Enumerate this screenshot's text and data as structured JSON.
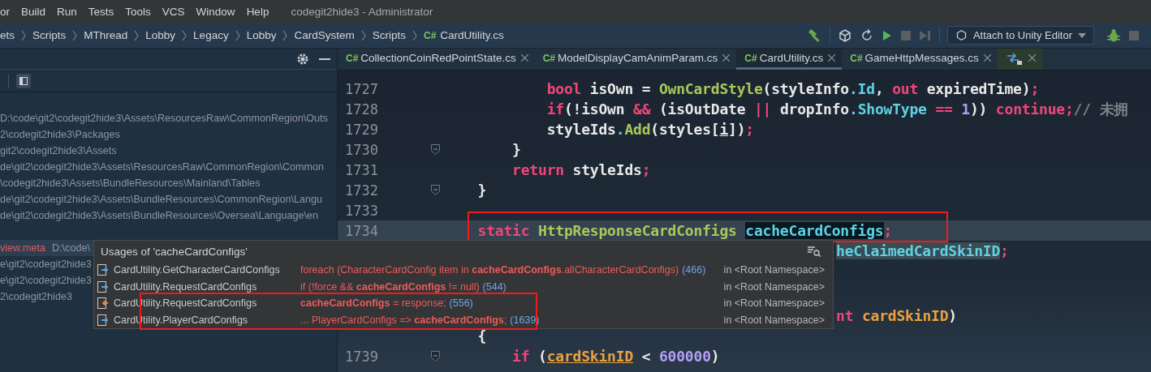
{
  "menu_bar": {
    "items": [
      "or",
      "Build",
      "Run",
      "Tests",
      "Tools",
      "VCS",
      "Window",
      "Help"
    ],
    "title": "codegit2hide3 - Administrator"
  },
  "breadcrumbs": [
    {
      "label": "ets"
    },
    {
      "label": "Scripts"
    },
    {
      "label": "MThread"
    },
    {
      "label": "Lobby"
    },
    {
      "label": "Legacy"
    },
    {
      "label": "Lobby"
    },
    {
      "label": "CardSystem"
    },
    {
      "label": "Scripts"
    },
    {
      "label": "CardUtility.cs",
      "badge": "C#"
    }
  ],
  "run_toolbar": {
    "config_label": "Attach to Unity Editor"
  },
  "side_panel": {
    "groups": [
      {
        "rows": [
          {
            "path": "D:\\code\\git2\\codegit2hide3\\Assets\\ResourcesRaw\\CommonRegion\\Outs",
            "selected": false
          },
          {
            "path": "2\\codegit2hide3\\Packages",
            "selected": false
          },
          {
            "path": "git2\\codegit2hide3\\Assets",
            "selected": false
          },
          {
            "path": "de\\git2\\codegit2hide3\\Assets\\ResourcesRaw\\CommonRegion\\Common",
            "selected": false
          },
          {
            "path": "\\codegit2hide3\\Assets\\BundleResources\\Mainland\\Tables",
            "selected": false
          },
          {
            "path": "de\\git2\\codegit2hide3\\Assets\\BundleResources\\CommonRegion\\Langu",
            "selected": false
          },
          {
            "path": "de\\git2\\codegit2hide3\\Assets\\BundleResources\\Oversea\\Language\\en",
            "selected": false
          }
        ]
      },
      {
        "rows": [
          {
            "file": "view.meta",
            "path": "D:\\code\\",
            "selected": true
          },
          {
            "path": "e\\git2\\codegit2hide3",
            "selected": false
          },
          {
            "path": "e\\git2\\codegit2hide3",
            "selected": false
          },
          {
            "path": "2\\codegit2hide3",
            "selected": false
          }
        ]
      }
    ]
  },
  "tabs": [
    {
      "kind": "file",
      "badge": "C#",
      "label": "CollectionCoinRedPointState.cs",
      "selected": false
    },
    {
      "kind": "file",
      "badge": "C#",
      "label": "ModelDisplayCamAnimParam.cs",
      "selected": false
    },
    {
      "kind": "file",
      "badge": "C#",
      "label": "CardUtility.cs",
      "selected": true
    },
    {
      "kind": "file",
      "badge": "C#",
      "label": "GameHttpMessages.cs",
      "selected": false
    },
    {
      "kind": "icon",
      "selected": false
    }
  ],
  "editor": {
    "lines": [
      {
        "kind": "code",
        "number": "1727",
        "fold": false,
        "current": false,
        "tokens": [
          {
            "text": "            bool ",
            "kind": "kw"
          },
          {
            "text": "isOwn = ",
            "kind": "id"
          },
          {
            "text": "OwnCardStyle",
            "kind": "fn"
          },
          {
            "text": "(",
            "kind": "plain"
          },
          {
            "text": "styleInfo",
            "kind": "id"
          },
          {
            "text": ".",
            "kind": "prop"
          },
          {
            "text": "Id",
            "kind": "prop"
          },
          {
            "text": ", ",
            "kind": "plain"
          },
          {
            "text": "out ",
            "kind": "kw"
          },
          {
            "text": "expiredTime",
            "kind": "id"
          },
          {
            "text": ")",
            "kind": "plain"
          },
          {
            "text": ";",
            "kind": "punct"
          }
        ]
      },
      {
        "kind": "code",
        "number": "1728",
        "fold": false,
        "current": false,
        "tokens": [
          {
            "text": "            if",
            "kind": "kw"
          },
          {
            "text": "(!",
            "kind": "plain"
          },
          {
            "text": "isOwn ",
            "kind": "id"
          },
          {
            "text": "&& ",
            "kind": "kw"
          },
          {
            "text": "(",
            "kind": "plain"
          },
          {
            "text": "isOutDate ",
            "kind": "id"
          },
          {
            "text": "|| ",
            "kind": "kw"
          },
          {
            "text": "dropInfo",
            "kind": "id"
          },
          {
            "text": ".",
            "kind": "prop"
          },
          {
            "text": "ShowType ",
            "kind": "prop"
          },
          {
            "text": "== ",
            "kind": "kw"
          },
          {
            "text": "1",
            "kind": "num"
          },
          {
            "text": ")) ",
            "kind": "plain"
          },
          {
            "text": "continue;",
            "kind": "kw"
          },
          {
            "text": "// 未拥",
            "kind": "cmt"
          }
        ]
      },
      {
        "kind": "code",
        "number": "1729",
        "fold": false,
        "current": false,
        "tokens": [
          {
            "text": "            styleIds",
            "kind": "id"
          },
          {
            "text": ".",
            "kind": "prop"
          },
          {
            "text": "Add",
            "kind": "fn"
          },
          {
            "text": "(",
            "kind": "plain"
          },
          {
            "text": "styles[",
            "kind": "id"
          },
          {
            "text": "i",
            "kind": "id_u"
          },
          {
            "text": "])",
            "kind": "plain"
          },
          {
            "text": ";",
            "kind": "punct"
          }
        ]
      },
      {
        "kind": "code",
        "number": "1730",
        "fold": true,
        "current": false,
        "tokens": [
          {
            "text": "        }",
            "kind": "plain"
          }
        ]
      },
      {
        "kind": "code",
        "number": "1731",
        "fold": false,
        "current": false,
        "tokens": [
          {
            "text": "        return ",
            "kind": "kw"
          },
          {
            "text": "styleIds",
            "kind": "id"
          },
          {
            "text": ";",
            "kind": "punct"
          }
        ]
      },
      {
        "kind": "code",
        "number": "1732",
        "fold": true,
        "current": false,
        "tokens": [
          {
            "text": "    }",
            "kind": "plain"
          }
        ]
      },
      {
        "kind": "code",
        "number": "1733",
        "fold": false,
        "current": false
      },
      {
        "kind": "code",
        "number": "1734",
        "fold": false,
        "current": true,
        "tokens": [
          {
            "text": "    static ",
            "kind": "kw"
          },
          {
            "text": "HttpResponseCardConfigs ",
            "kind": "type"
          },
          {
            "text": "cacheCardConfigs",
            "kind": "field_hl"
          },
          {
            "text": ";",
            "kind": "punct"
          }
        ]
      },
      {
        "kind": "covered",
        "tokens": [
          {
            "text": "heClaimedCardSkinID",
            "kind": "field_ref"
          },
          {
            "text": ";",
            "kind": "punct"
          }
        ]
      },
      {
        "kind": "covered_blank"
      },
      {
        "kind": "covered",
        "tokens": [
          {
            "text": "nt ",
            "kind": "kw"
          },
          {
            "text": "cardSkinID",
            "kind": "param"
          },
          {
            "text": ")",
            "kind": "plain"
          }
        ]
      },
      {
        "kind": "code",
        "fold": false,
        "current": false,
        "tokens": [
          {
            "text": "    {",
            "kind": "plain"
          }
        ]
      },
      {
        "kind": "code",
        "number": "1739",
        "fold": true,
        "current": false,
        "tokens": [
          {
            "text": "        if ",
            "kind": "kw"
          },
          {
            "text": "(",
            "kind": "plain"
          },
          {
            "text": "cardSkinID",
            "kind": "param_u"
          },
          {
            "text": " < ",
            "kind": "plain"
          },
          {
            "text": "600000",
            "kind": "num"
          },
          {
            "text": ")",
            "kind": "plain"
          }
        ]
      }
    ]
  },
  "usages_popup": {
    "title": "Usages of 'cacheCardConfigs'",
    "rows": [
      {
        "kind": "read",
        "method": "CardUtility.GetCharacterCardConfigs",
        "snippet": "foreach (CharacterCardConfig item in **cacheCardConfigs**.allCharacterCardConfigs)",
        "line": "(466)",
        "scope": "in <Root Namespace>"
      },
      {
        "kind": "read",
        "method": "CardUtility.RequestCardConfigs",
        "snippet": "if (!force && **cacheCardConfigs** != null)",
        "line": "(544)",
        "scope": "in <Root Namespace>"
      },
      {
        "kind": "write",
        "method": "CardUtility.RequestCardConfigs",
        "snippet": "**cacheCardConfigs** = response;",
        "line": "(556)",
        "scope": "in <Root Namespace>"
      },
      {
        "kind": "read",
        "method": "CardUtility.PlayerCardConfigs",
        "snippet": "... PlayerCardConfigs => **cacheCardConfigs**;",
        "line": "(1639)",
        "scope": "in <Root Namespace>"
      }
    ]
  }
}
